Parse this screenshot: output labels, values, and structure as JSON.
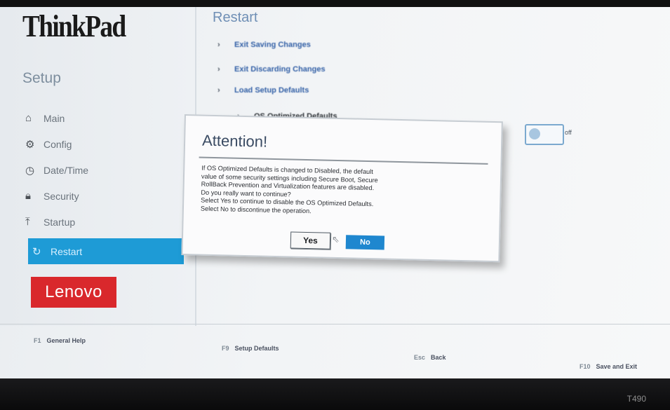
{
  "app": {
    "brand": "ThinkPad",
    "section_title": "Setup",
    "model": "T490"
  },
  "sidebar": {
    "items": [
      {
        "label": "Main",
        "icon": "home-icon",
        "active": false
      },
      {
        "label": "Config",
        "icon": "config-icon",
        "active": false
      },
      {
        "label": "Date/Time",
        "icon": "clock-icon",
        "active": false
      },
      {
        "label": "Security",
        "icon": "lock-icon",
        "active": false
      },
      {
        "label": "Startup",
        "icon": "upload-icon",
        "active": false
      },
      {
        "label": "Restart",
        "icon": "restart-icon",
        "active": true
      }
    ],
    "vendor_logo": "Lenovo"
  },
  "main": {
    "title": "Restart",
    "options": [
      "Exit Saving Changes",
      "Exit Discarding Changes",
      "Load Setup Defaults",
      "OS Optimized Defaults"
    ],
    "toggle_state": "off"
  },
  "footer": {
    "help": {
      "key": "F1",
      "label": "General Help"
    },
    "defaults": {
      "key": "F9",
      "label": "Setup Defaults"
    },
    "back": {
      "key": "Esc",
      "label": "Back"
    },
    "save": {
      "key": "F10",
      "label": "Save and Exit"
    }
  },
  "dialog": {
    "title": "Attention!",
    "lines": [
      "If OS Optimized Defaults is changed to Disabled, the default",
      "value of some security settings including Secure Boot, Secure",
      "RollBack Prevention and Virtualization features are disabled.",
      "Do you really want to continue?",
      "Select Yes to continue to disable the OS Optimized Defaults.",
      "Select No  to discontinue the operation."
    ],
    "yes_label": "Yes",
    "no_label": "No"
  },
  "colors": {
    "accent": "#1e9bd6",
    "lenovo_red": "#d9282c",
    "button_blue": "#1f87cf"
  }
}
